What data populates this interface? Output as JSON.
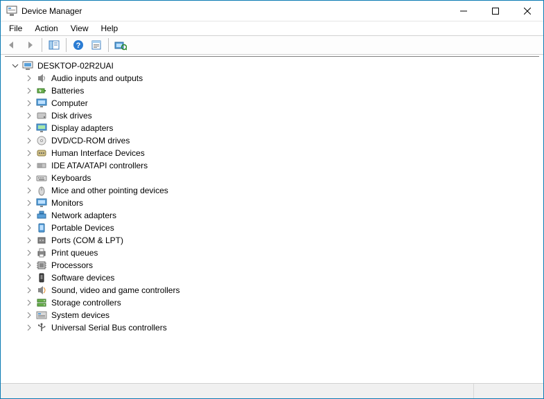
{
  "window": {
    "title": "Device Manager",
    "minimize": "Minimize",
    "maximize": "Maximize",
    "close": "Close"
  },
  "menu": {
    "file": "File",
    "action": "Action",
    "view": "View",
    "help": "Help"
  },
  "toolbar": {
    "back": "Back",
    "forward": "Forward",
    "show_hide": "Show/Hide Console Tree",
    "help": "Help",
    "properties": "Properties",
    "scan": "Scan for hardware changes"
  },
  "tree": {
    "root": "DESKTOP-02R2UAI",
    "items": [
      {
        "label": "Audio inputs and outputs",
        "icon": "speaker"
      },
      {
        "label": "Batteries",
        "icon": "battery"
      },
      {
        "label": "Computer",
        "icon": "monitor"
      },
      {
        "label": "Disk drives",
        "icon": "disk"
      },
      {
        "label": "Display adapters",
        "icon": "display"
      },
      {
        "label": "DVD/CD-ROM drives",
        "icon": "disc"
      },
      {
        "label": "Human Interface Devices",
        "icon": "hid"
      },
      {
        "label": "IDE ATA/ATAPI controllers",
        "icon": "ide"
      },
      {
        "label": "Keyboards",
        "icon": "keyboard"
      },
      {
        "label": "Mice and other pointing devices",
        "icon": "mouse"
      },
      {
        "label": "Monitors",
        "icon": "monitor"
      },
      {
        "label": "Network adapters",
        "icon": "network"
      },
      {
        "label": "Portable Devices",
        "icon": "portable"
      },
      {
        "label": "Ports (COM & LPT)",
        "icon": "port"
      },
      {
        "label": "Print queues",
        "icon": "printer"
      },
      {
        "label": "Processors",
        "icon": "cpu"
      },
      {
        "label": "Software devices",
        "icon": "software"
      },
      {
        "label": "Sound, video and game controllers",
        "icon": "sound"
      },
      {
        "label": "Storage controllers",
        "icon": "storage"
      },
      {
        "label": "System devices",
        "icon": "system"
      },
      {
        "label": "Universal Serial Bus controllers",
        "icon": "usb"
      }
    ]
  }
}
